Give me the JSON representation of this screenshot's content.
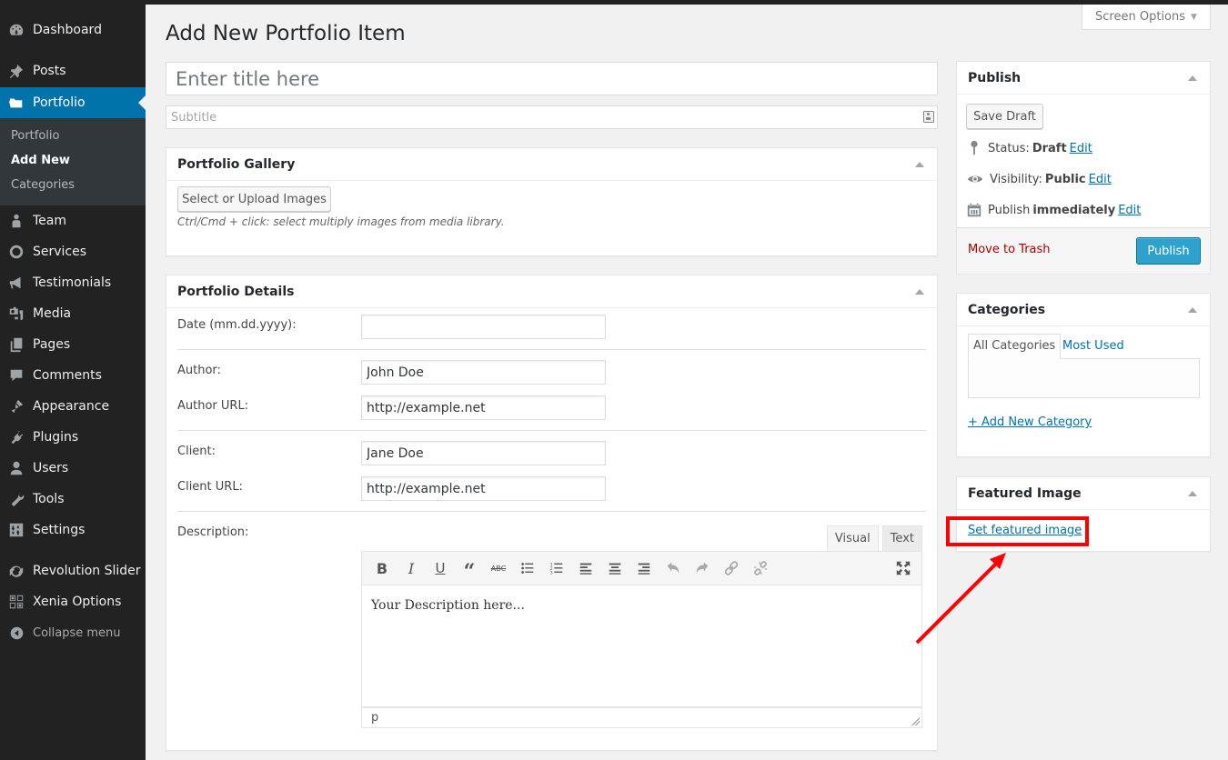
{
  "sidebar": {
    "items": [
      {
        "label": "Dashboard",
        "icon": "dashboard-icon"
      },
      {
        "label": "Posts",
        "icon": "pin-icon"
      },
      {
        "label": "Portfolio",
        "icon": "folder-icon",
        "active": true
      },
      {
        "label": "Team",
        "icon": "person-icon"
      },
      {
        "label": "Services",
        "icon": "circle-icon"
      },
      {
        "label": "Testimonials",
        "icon": "megaphone-icon"
      },
      {
        "label": "Media",
        "icon": "media-icon"
      },
      {
        "label": "Pages",
        "icon": "pages-icon"
      },
      {
        "label": "Comments",
        "icon": "comment-icon"
      },
      {
        "label": "Appearance",
        "icon": "paintbrush-icon"
      },
      {
        "label": "Plugins",
        "icon": "plug-icon"
      },
      {
        "label": "Users",
        "icon": "user-icon"
      },
      {
        "label": "Tools",
        "icon": "wrench-icon"
      },
      {
        "label": "Settings",
        "icon": "sliders-icon"
      },
      {
        "label": "Revolution Slider",
        "icon": "refresh-icon"
      },
      {
        "label": "Xenia Options",
        "icon": "grid-icon"
      }
    ],
    "submenu": [
      {
        "label": "Portfolio"
      },
      {
        "label": "Add New",
        "current": true
      },
      {
        "label": "Categories"
      }
    ],
    "collapse_label": "Collapse menu"
  },
  "header": {
    "title": "Add New Portfolio Item",
    "screen_options": "Screen Options"
  },
  "title_field": {
    "placeholder": "Enter title here",
    "value": ""
  },
  "subtitle_field": {
    "placeholder": "Subtitle",
    "value": ""
  },
  "gallery": {
    "title": "Portfolio Gallery",
    "button": "Select or Upload Images",
    "hint": "Ctrl/Cmd + click: select multiply images from media library."
  },
  "details": {
    "title": "Portfolio Details",
    "fields": [
      {
        "label": "Date (mm.dd.yyyy):",
        "value": ""
      },
      {
        "label": "Author:",
        "value": "John Doe"
      },
      {
        "label": "Author URL:",
        "value": "http://example.net"
      },
      {
        "label": "Client:",
        "value": "Jane Doe"
      },
      {
        "label": "Client URL:",
        "value": "http://example.net"
      }
    ],
    "description_label": "Description:",
    "editor": {
      "tabs": [
        "Visual",
        "Text"
      ],
      "active_tab": "Visual",
      "toolbar": [
        "bold",
        "italic",
        "underline",
        "blockquote",
        "strikethrough",
        "bullet-list",
        "numbered-list",
        "align-left",
        "align-center",
        "align-right",
        "undo",
        "redo",
        "link",
        "unlink",
        "fullscreen"
      ],
      "content": "Your Description here...",
      "status_path": "p"
    }
  },
  "publish": {
    "title": "Publish",
    "save_draft": "Save Draft",
    "status_label": "Status:",
    "status_value": "Draft",
    "visibility_label": "Visibility:",
    "visibility_value": "Public",
    "publish_label": "Publish",
    "publish_value": "immediately",
    "edit": "Edit",
    "trash": "Move to Trash",
    "publish_button": "Publish"
  },
  "categories": {
    "title": "Categories",
    "tabs": [
      "All Categories",
      "Most Used"
    ],
    "add_new": "+ Add New Category"
  },
  "featured_image": {
    "title": "Featured Image",
    "link": "Set featured image"
  },
  "annotation": {
    "color": "#ff0000"
  }
}
